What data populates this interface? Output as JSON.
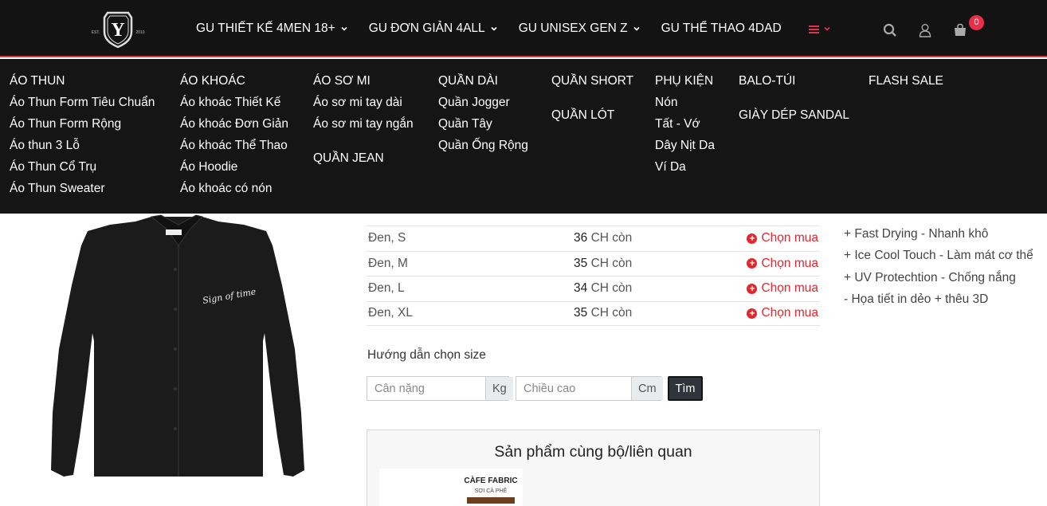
{
  "header": {
    "logo": {
      "letter": "Y",
      "left_text": "EST.",
      "right_text": "2010"
    },
    "nav": [
      {
        "label": "GU THIẾT KẾ 4MEN 18+",
        "has_dropdown": true
      },
      {
        "label": "GU ĐƠN GIẢN 4ALL",
        "has_dropdown": true
      },
      {
        "label": "GU UNISEX GEN Z",
        "has_dropdown": true
      },
      {
        "label": "GU THỂ THAO 4DAD",
        "has_dropdown": false
      }
    ],
    "menu_icon": "hamburger-icon",
    "icons": [
      "search-icon",
      "user-icon",
      "cart-icon"
    ],
    "cart_count": "0",
    "accent": "#e8304b"
  },
  "mega_menu": {
    "columns": [
      {
        "head": "ÁO THUN",
        "items": [
          "Áo Thun Form Tiêu Chuẩn",
          "Áo Thun Form Rộng",
          "Áo thun 3 Lỗ",
          "Áo Thun Cổ Trụ",
          "Áo Thun Sweater"
        ]
      },
      {
        "head": "ÁO KHOÁC",
        "items": [
          "Áo khoác Thiết Kế",
          "Áo khoác Đơn Giản",
          "Áo khoác Thể Thao",
          "Áo Hoodie",
          "Áo khoác có nón"
        ]
      },
      {
        "head": "ÁO SƠ MI",
        "items": [
          "Áo sơ mi tay dài",
          "Áo sơ mi tay ngắn"
        ],
        "head2": "QUẦN JEAN"
      },
      {
        "head": "QUẦN DÀI",
        "items": [
          "Quần Jogger",
          "Quần Tây",
          "Quần Ống Rộng"
        ]
      },
      {
        "head": "QUẦN SHORT",
        "head2": "QUẦN LÓT"
      },
      {
        "head": "PHỤ KIỆN",
        "items": [
          "Nón",
          "Tất - Vớ",
          "Dây Nịt Da",
          "Ví Da"
        ]
      },
      {
        "head": "BALO-TÚI",
        "head2": "GIÀY DÉP SANDAL"
      },
      {
        "head": "FLASH SALE"
      }
    ]
  },
  "product": {
    "image_print": "Sign of time"
  },
  "variants": {
    "stock_suffix": "CH còn",
    "buy_label": "Chọn mua",
    "rows": [
      {
        "name": "Đen, S",
        "stock": "36"
      },
      {
        "name": "Đen, M",
        "stock": "35"
      },
      {
        "name": "Đen, L",
        "stock": "34"
      },
      {
        "name": "Đen, XL",
        "stock": "35"
      }
    ]
  },
  "size_guide": {
    "title": "Hướng dẫn chọn size",
    "weight_placeholder": "Cân nặng",
    "weight_unit": "Kg",
    "height_placeholder": "Chiều cao",
    "height_unit": "Cm",
    "find_label": "Tìm"
  },
  "related": {
    "title": "Sản phẩm cùng bộ/liên quan",
    "thumb_line1": "CÀFE FABRIC",
    "thumb_line2": "SỢI CÀ PHÊ"
  },
  "features": [
    "+ Fast Drying - Nhanh khô",
    "+ Ice Cool Touch - Làm mát cơ thể",
    "+ UV Protechtion - Chống nắng",
    "- Họa tiết in dẻo + thêu 3D"
  ]
}
